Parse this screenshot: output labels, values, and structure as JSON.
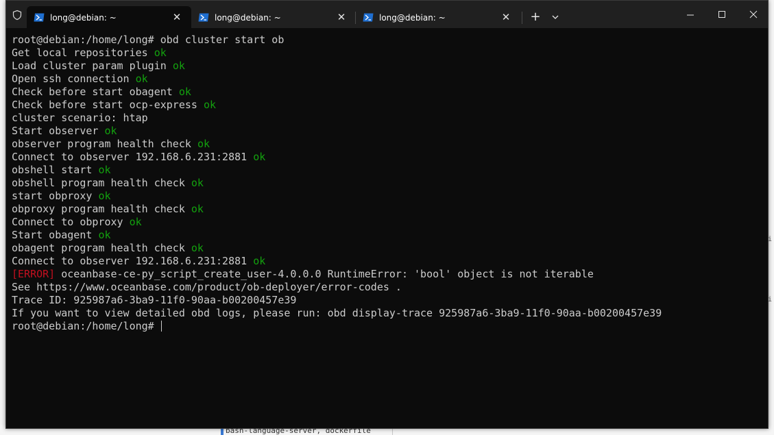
{
  "tabs": [
    {
      "label": "long@debian: ~",
      "active": true
    },
    {
      "label": "long@debian: ~",
      "active": false
    },
    {
      "label": "long@debian: ~",
      "active": false
    }
  ],
  "icons": {
    "shield": "shield-icon",
    "tab": "powershell-icon",
    "close": "close-icon",
    "new_tab": "plus-icon",
    "dropdown": "chevron-down-icon",
    "minimize": "minimize-icon",
    "maximize": "maximize-icon",
    "window_close": "close-icon"
  },
  "colors": {
    "background": "#0c0c0c",
    "text": "#cccccc",
    "ok": "#13a10e",
    "error": "#c50f1f",
    "titlebar": "#202020"
  },
  "terminal": {
    "lines": [
      {
        "text": "root@debian:/home/long# obd cluster start ob"
      },
      {
        "text": "Get local repositories",
        "status": "ok"
      },
      {
        "text": "Load cluster param plugin",
        "status": "ok"
      },
      {
        "text": "Open ssh connection",
        "status": "ok"
      },
      {
        "text": "Check before start obagent",
        "status": "ok"
      },
      {
        "text": "Check before start ocp-express",
        "status": "ok"
      },
      {
        "text": "cluster scenario: htap"
      },
      {
        "text": "Start observer",
        "status": "ok"
      },
      {
        "text": "observer program health check",
        "status": "ok"
      },
      {
        "text": "Connect to observer 192.168.6.231:2881",
        "status": "ok"
      },
      {
        "text": "obshell start",
        "status": "ok"
      },
      {
        "text": "obshell program health check",
        "status": "ok"
      },
      {
        "text": "start obproxy",
        "status": "ok"
      },
      {
        "text": "obproxy program health check",
        "status": "ok"
      },
      {
        "text": "Connect to obproxy",
        "status": "ok"
      },
      {
        "text": "Start obagent",
        "status": "ok"
      },
      {
        "text": "obagent program health check",
        "status": "ok"
      },
      {
        "text": "Connect to observer 192.168.6.231:2881",
        "status": "ok"
      },
      {
        "prefix": "[ERROR]",
        "text": "oceanbase-ce-py_script_create_user-4.0.0.0 RuntimeError: 'bool' object is not iterable"
      },
      {
        "text": "See https://www.oceanbase.com/product/ob-deployer/error-codes ."
      },
      {
        "text": "Trace ID: 925987a6-3ba9-11f0-90aa-b00200457e39"
      },
      {
        "text": "If you want to view detailed obd logs, please run: obd display-trace 925987a6-3ba9-11f0-90aa-b00200457e39"
      }
    ],
    "prompt": "root@debian:/home/long# "
  },
  "background": {
    "snippet": "bash-language-server, dockerfile",
    "right_marks": [
      "i",
      "i"
    ]
  }
}
